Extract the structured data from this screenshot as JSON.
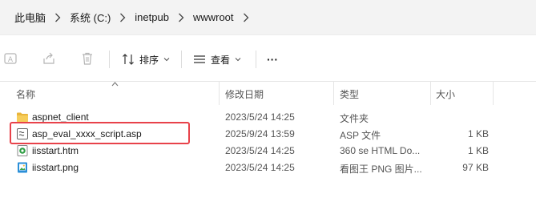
{
  "breadcrumb": [
    "此电脑",
    "系统 (C:)",
    "inetpub",
    "wwwroot"
  ],
  "toolbar": {
    "sort_label": "排序",
    "view_label": "查看",
    "more_label": "···"
  },
  "columns": {
    "name": "名称",
    "date": "修改日期",
    "type": "类型",
    "size": "大小"
  },
  "files": [
    {
      "name": "aspnet_client",
      "date": "2023/5/24 14:25",
      "type": "文件夹",
      "size": "",
      "icon": "folder-icon"
    },
    {
      "name": "asp_eval_xxxx_script.asp",
      "date": "2025/9/24 13:59",
      "type": "ASP 文件",
      "size": "1 KB",
      "icon": "asp-file-icon"
    },
    {
      "name": "iisstart.htm",
      "date": "2023/5/24 14:25",
      "type": "360 se HTML Do...",
      "size": "1 KB",
      "icon": "html-file-icon"
    },
    {
      "name": "iisstart.png",
      "date": "2023/5/24 14:25",
      "type": "看图王 PNG 图片...",
      "size": "97 KB",
      "icon": "png-file-icon"
    }
  ],
  "colors": {
    "highlight": "#e8424a",
    "folder": "#f0c24b"
  }
}
